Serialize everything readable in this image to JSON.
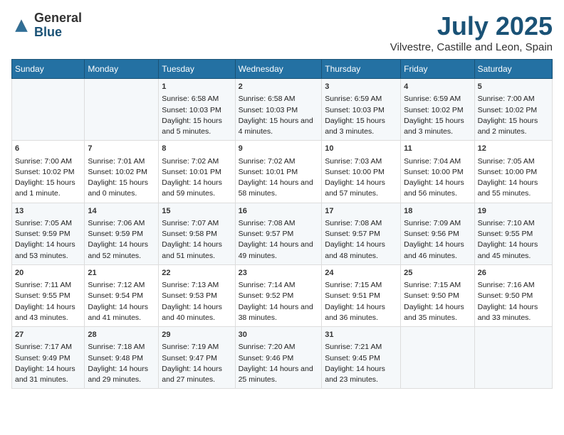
{
  "header": {
    "logo_general": "General",
    "logo_blue": "Blue",
    "title": "July 2025",
    "subtitle": "Vilvestre, Castille and Leon, Spain"
  },
  "weekdays": [
    "Sunday",
    "Monday",
    "Tuesday",
    "Wednesday",
    "Thursday",
    "Friday",
    "Saturday"
  ],
  "weeks": [
    {
      "cells": [
        {
          "day": "",
          "info": ""
        },
        {
          "day": "",
          "info": ""
        },
        {
          "day": "1",
          "info": "Sunrise: 6:58 AM\nSunset: 10:03 PM\nDaylight: 15 hours\nand 5 minutes."
        },
        {
          "day": "2",
          "info": "Sunrise: 6:58 AM\nSunset: 10:03 PM\nDaylight: 15 hours\nand 4 minutes."
        },
        {
          "day": "3",
          "info": "Sunrise: 6:59 AM\nSunset: 10:03 PM\nDaylight: 15 hours\nand 3 minutes."
        },
        {
          "day": "4",
          "info": "Sunrise: 6:59 AM\nSunset: 10:02 PM\nDaylight: 15 hours\nand 3 minutes."
        },
        {
          "day": "5",
          "info": "Sunrise: 7:00 AM\nSunset: 10:02 PM\nDaylight: 15 hours\nand 2 minutes."
        }
      ]
    },
    {
      "cells": [
        {
          "day": "6",
          "info": "Sunrise: 7:00 AM\nSunset: 10:02 PM\nDaylight: 15 hours\nand 1 minute."
        },
        {
          "day": "7",
          "info": "Sunrise: 7:01 AM\nSunset: 10:02 PM\nDaylight: 15 hours\nand 0 minutes."
        },
        {
          "day": "8",
          "info": "Sunrise: 7:02 AM\nSunset: 10:01 PM\nDaylight: 14 hours\nand 59 minutes."
        },
        {
          "day": "9",
          "info": "Sunrise: 7:02 AM\nSunset: 10:01 PM\nDaylight: 14 hours\nand 58 minutes."
        },
        {
          "day": "10",
          "info": "Sunrise: 7:03 AM\nSunset: 10:00 PM\nDaylight: 14 hours\nand 57 minutes."
        },
        {
          "day": "11",
          "info": "Sunrise: 7:04 AM\nSunset: 10:00 PM\nDaylight: 14 hours\nand 56 minutes."
        },
        {
          "day": "12",
          "info": "Sunrise: 7:05 AM\nSunset: 10:00 PM\nDaylight: 14 hours\nand 55 minutes."
        }
      ]
    },
    {
      "cells": [
        {
          "day": "13",
          "info": "Sunrise: 7:05 AM\nSunset: 9:59 PM\nDaylight: 14 hours\nand 53 minutes."
        },
        {
          "day": "14",
          "info": "Sunrise: 7:06 AM\nSunset: 9:59 PM\nDaylight: 14 hours\nand 52 minutes."
        },
        {
          "day": "15",
          "info": "Sunrise: 7:07 AM\nSunset: 9:58 PM\nDaylight: 14 hours\nand 51 minutes."
        },
        {
          "day": "16",
          "info": "Sunrise: 7:08 AM\nSunset: 9:57 PM\nDaylight: 14 hours\nand 49 minutes."
        },
        {
          "day": "17",
          "info": "Sunrise: 7:08 AM\nSunset: 9:57 PM\nDaylight: 14 hours\nand 48 minutes."
        },
        {
          "day": "18",
          "info": "Sunrise: 7:09 AM\nSunset: 9:56 PM\nDaylight: 14 hours\nand 46 minutes."
        },
        {
          "day": "19",
          "info": "Sunrise: 7:10 AM\nSunset: 9:55 PM\nDaylight: 14 hours\nand 45 minutes."
        }
      ]
    },
    {
      "cells": [
        {
          "day": "20",
          "info": "Sunrise: 7:11 AM\nSunset: 9:55 PM\nDaylight: 14 hours\nand 43 minutes."
        },
        {
          "day": "21",
          "info": "Sunrise: 7:12 AM\nSunset: 9:54 PM\nDaylight: 14 hours\nand 41 minutes."
        },
        {
          "day": "22",
          "info": "Sunrise: 7:13 AM\nSunset: 9:53 PM\nDaylight: 14 hours\nand 40 minutes."
        },
        {
          "day": "23",
          "info": "Sunrise: 7:14 AM\nSunset: 9:52 PM\nDaylight: 14 hours\nand 38 minutes."
        },
        {
          "day": "24",
          "info": "Sunrise: 7:15 AM\nSunset: 9:51 PM\nDaylight: 14 hours\nand 36 minutes."
        },
        {
          "day": "25",
          "info": "Sunrise: 7:15 AM\nSunset: 9:50 PM\nDaylight: 14 hours\nand 35 minutes."
        },
        {
          "day": "26",
          "info": "Sunrise: 7:16 AM\nSunset: 9:50 PM\nDaylight: 14 hours\nand 33 minutes."
        }
      ]
    },
    {
      "cells": [
        {
          "day": "27",
          "info": "Sunrise: 7:17 AM\nSunset: 9:49 PM\nDaylight: 14 hours\nand 31 minutes."
        },
        {
          "day": "28",
          "info": "Sunrise: 7:18 AM\nSunset: 9:48 PM\nDaylight: 14 hours\nand 29 minutes."
        },
        {
          "day": "29",
          "info": "Sunrise: 7:19 AM\nSunset: 9:47 PM\nDaylight: 14 hours\nand 27 minutes."
        },
        {
          "day": "30",
          "info": "Sunrise: 7:20 AM\nSunset: 9:46 PM\nDaylight: 14 hours\nand 25 minutes."
        },
        {
          "day": "31",
          "info": "Sunrise: 7:21 AM\nSunset: 9:45 PM\nDaylight: 14 hours\nand 23 minutes."
        },
        {
          "day": "",
          "info": ""
        },
        {
          "day": "",
          "info": ""
        }
      ]
    }
  ]
}
